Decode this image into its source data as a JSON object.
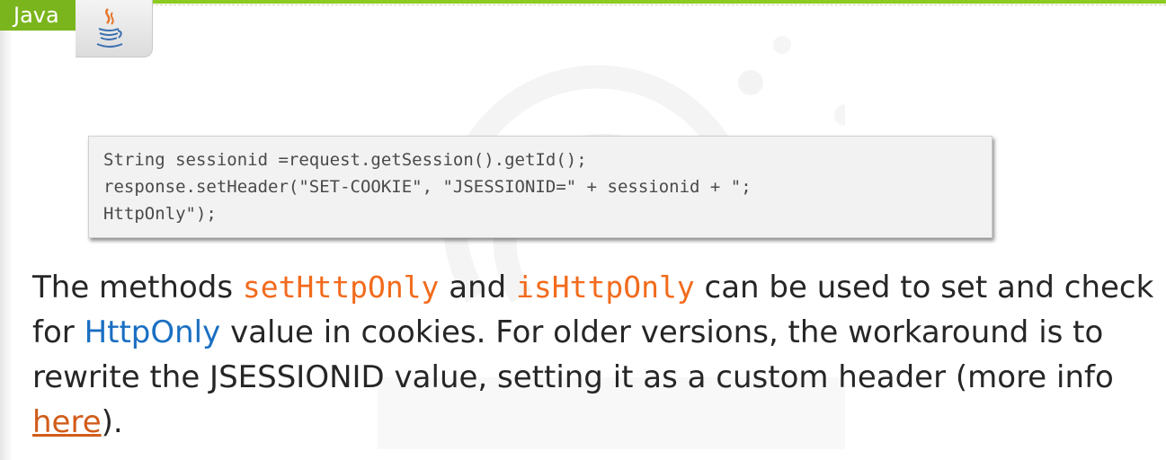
{
  "tag": {
    "label": "Java",
    "logo_icon": "java-coffee-cup-icon"
  },
  "colors": {
    "accent_green": "#7ab51d",
    "method_orange": "#f26b1d",
    "term_blue": "#1a6fc2",
    "link_orange": "#d15c1a"
  },
  "code": {
    "lines": [
      "String sessionid =request.getSession().getId();",
      "response.setHeader(\"SET-COOKIE\", \"JSESSIONID=\" + sessionid + \";",
      "HttpOnly\");"
    ]
  },
  "paragraph": {
    "part1": "The methods ",
    "method1": "setHttpOnly",
    "part2": " and ",
    "method2": "isHttpOnly",
    "part3": " can be used to set and check for ",
    "term": "HttpOnly",
    "part4": " value in cookies. For older versions, the workaround is to rewrite the JSESSIONID value, setting it as a custom header (more info ",
    "link": "here",
    "part5": ")."
  }
}
